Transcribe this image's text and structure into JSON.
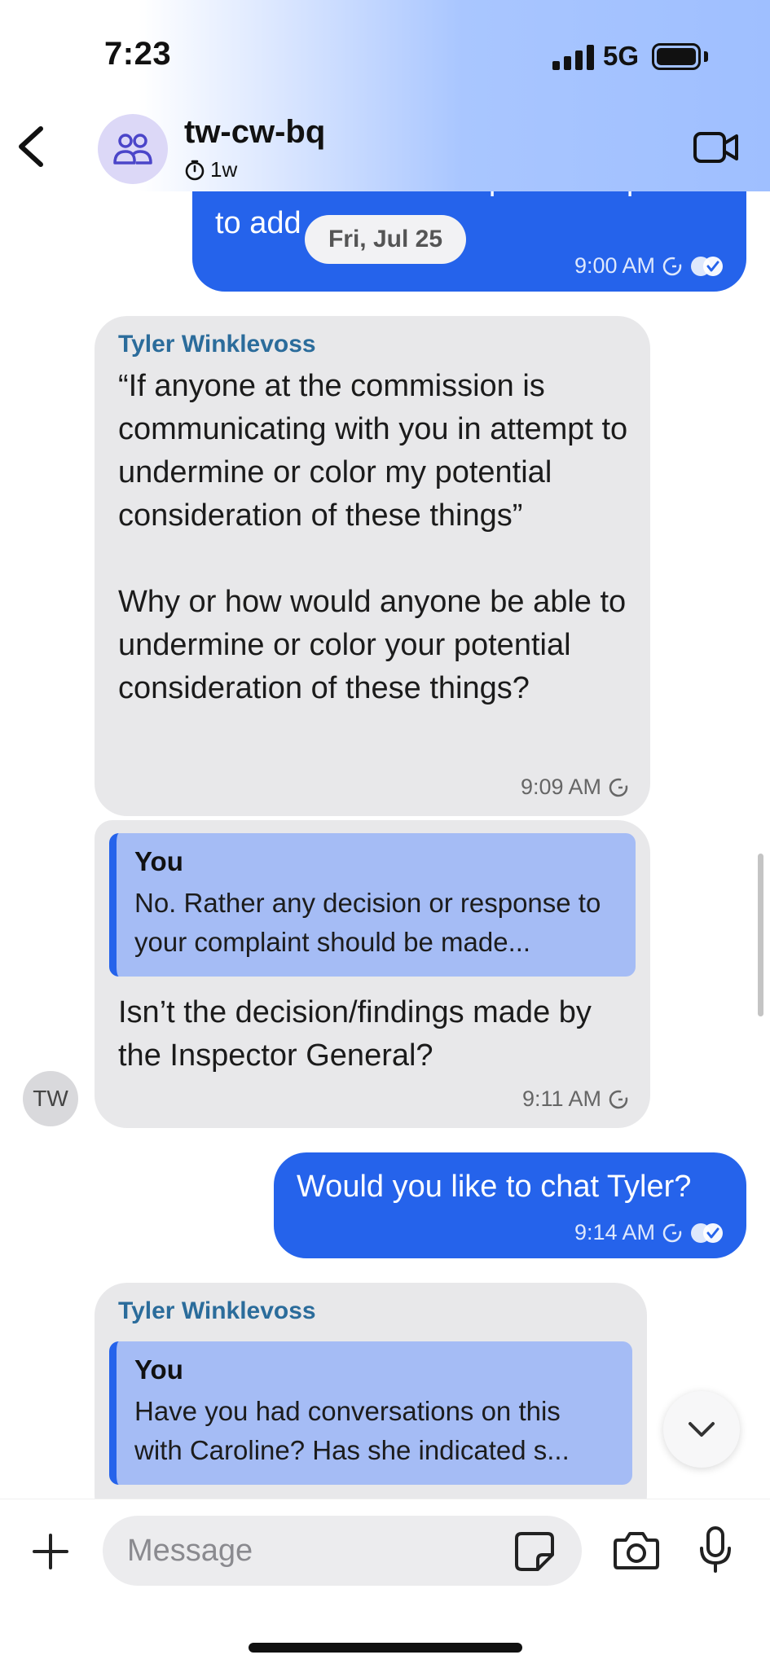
{
  "status_bar": {
    "time": "7:23",
    "network": "5G"
  },
  "header": {
    "title": "tw-cw-bq",
    "subtitle": "1w"
  },
  "date_chip": "Fri, Jul 25",
  "messages": [
    {
      "direction": "out",
      "lines": [
        "indicated she took specific steps",
        "to add"
      ],
      "time": "9:00 AM"
    },
    {
      "direction": "in",
      "sender": "Tyler Winklevoss",
      "text": "“If anyone at the commission is communicating with you in attempt to undermine or color my potential consideration of these things”\n\nWhy or how would anyone be able to undermine or color your potential consideration of these things?",
      "time": "9:09 AM"
    },
    {
      "direction": "in",
      "quote": {
        "author": "You",
        "text": "No. Rather any decision or response to your complaint should be made..."
      },
      "text": "Isn’t the decision/findings made by the Inspector General?",
      "time": "9:11 AM"
    },
    {
      "direction": "out",
      "text": "Would you like to chat Tyler?",
      "time": "9:14 AM"
    },
    {
      "direction": "in",
      "sender": "Tyler Winklevoss",
      "quote": {
        "author": "You",
        "text": "Have you had conversations on this with Caroline? Has she indicated s..."
      }
    }
  ],
  "sender_avatar_initials": "TW",
  "composer": {
    "placeholder": "Message"
  },
  "colors": {
    "outgoing_bubble": "#2563eb",
    "incoming_bubble": "#e8e8ea",
    "sender_name": "#2b6c9b",
    "quote_bg": "#a5bcf5"
  },
  "icons": {
    "back": "chevron-left-icon",
    "group": "group-icon",
    "timer": "timer-icon",
    "video": "video-camera-icon",
    "scroll_down": "chevron-down-icon",
    "plus": "plus-icon",
    "sticker": "sticker-icon",
    "camera": "camera-icon",
    "mic": "microphone-icon"
  }
}
